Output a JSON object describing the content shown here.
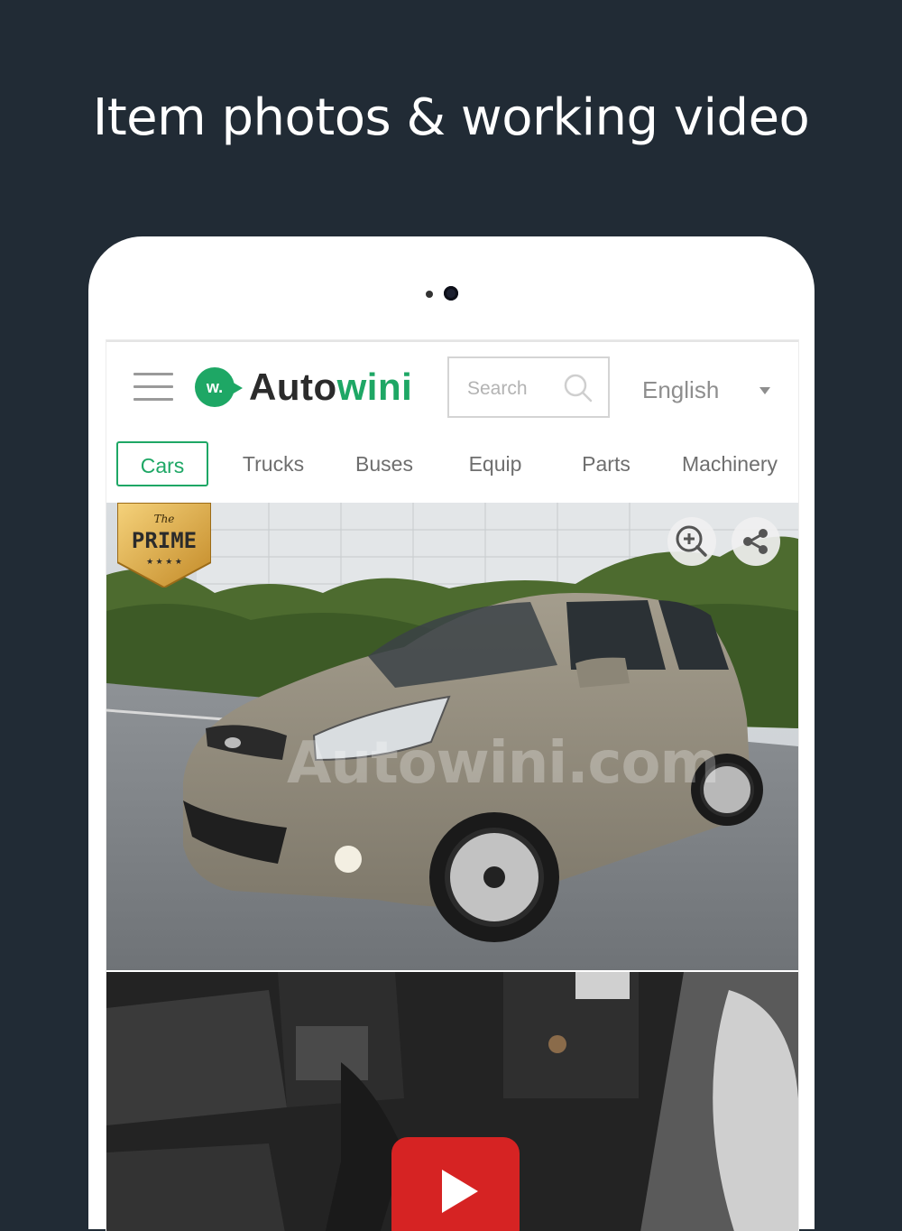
{
  "headline": "Item photos & working video",
  "header": {
    "logo_text_auto": "Auto",
    "logo_text_wini": "wini",
    "logo_mark": "w.",
    "search_placeholder": "Search",
    "language": "English"
  },
  "tabs": [
    {
      "label": "Cars",
      "active": true
    },
    {
      "label": "Trucks",
      "active": false
    },
    {
      "label": "Buses",
      "active": false
    },
    {
      "label": "Equip",
      "active": false
    },
    {
      "label": "Parts",
      "active": false
    },
    {
      "label": "Machinery",
      "active": false
    }
  ],
  "listing": {
    "badge_small": "The",
    "badge_main": "PRIME",
    "watermark": "Autowini.com",
    "icons": [
      "zoom-in-icon",
      "share-icon",
      "play-icon"
    ]
  },
  "colors": {
    "background": "#212b35",
    "brand_green": "#1ea765",
    "youtube_red": "#d62323"
  }
}
